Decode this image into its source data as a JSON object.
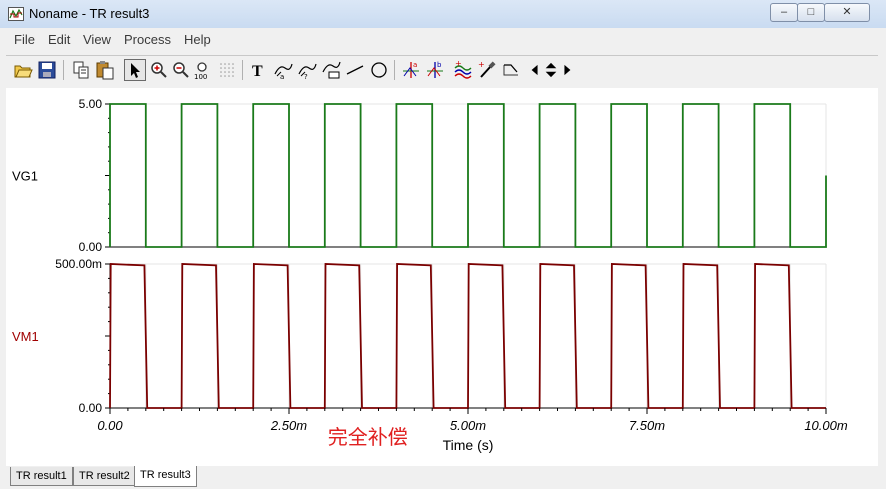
{
  "window": {
    "title": "Noname - TR result3",
    "minimize": "–",
    "maximize": "□",
    "close": "✕"
  },
  "menu": [
    "File",
    "Edit",
    "View",
    "Process",
    "Help"
  ],
  "toolbar": {
    "buttons": [
      "open-icon",
      "save-icon",
      "copy-icon",
      "paste-icon",
      "pointer-icon",
      "zoom-in-icon",
      "zoom-out-icon",
      "zoom-100-icon",
      "grid-icon",
      "text-icon",
      "label-a-icon",
      "label-b-icon",
      "legend-icon",
      "line-icon",
      "circle-icon",
      "cursor-a-icon",
      "cursor-b-icon",
      "curves-icon",
      "probe-icon",
      "step-icon",
      "left-arrow-icon",
      "up-down-icon",
      "right-arrow-icon"
    ]
  },
  "chart_data": [
    {
      "type": "line",
      "ylabel": "VG1",
      "ylim": [
        0,
        5
      ],
      "y_tick_labels": [
        "5.00",
        "0.00"
      ],
      "grid": true,
      "color": "#1a7a1a",
      "series": [
        {
          "name": "VG1",
          "x": [
            0,
            0,
            0.5,
            0.5,
            1.0,
            1.0,
            1.5,
            1.5,
            2.0,
            2.0,
            2.5,
            2.5,
            3.0,
            3.0,
            3.5,
            3.5,
            4.0,
            4.0,
            4.5,
            4.5,
            5.0,
            5.0,
            5.5,
            5.5,
            6.0,
            6.0,
            6.5,
            6.5,
            7.0,
            7.0,
            7.5,
            7.5,
            8.0,
            8.0,
            8.5,
            8.5,
            9.0,
            9.0,
            9.5,
            9.5,
            10.0,
            10.0
          ],
          "values": [
            0,
            5,
            5,
            0,
            0,
            5,
            5,
            0,
            0,
            5,
            5,
            0,
            0,
            5,
            5,
            0,
            0,
            5,
            5,
            0,
            0,
            5,
            5,
            0,
            0,
            5,
            5,
            0,
            0,
            5,
            5,
            0,
            0,
            5,
            5,
            0,
            0,
            5,
            5,
            0,
            0,
            2.5
          ]
        }
      ]
    },
    {
      "type": "line",
      "ylabel": "VM1",
      "xlabel": "Time (s)",
      "x_unit": "ms",
      "xlim": [
        0,
        10
      ],
      "ylim": [
        0,
        500
      ],
      "x_tick_labels": [
        "0.00",
        "2.50m",
        "5.00m",
        "7.50m",
        "10.00m"
      ],
      "y_tick_labels": [
        "500.00m",
        "0.00"
      ],
      "grid": true,
      "color": "#7a0000",
      "annotation": "完全补偿",
      "annotation_color": "#e02020",
      "series": [
        {
          "name": "VM1",
          "x": [
            0,
            0.01,
            0.48,
            0.52,
            1.0,
            1.01,
            1.48,
            1.52,
            2.0,
            2.01,
            2.48,
            2.52,
            3.0,
            3.01,
            3.48,
            3.52,
            4.0,
            4.01,
            4.48,
            4.52,
            5.0,
            5.01,
            5.48,
            5.52,
            6.0,
            6.01,
            6.48,
            6.52,
            7.0,
            7.01,
            7.48,
            7.52,
            8.0,
            8.01,
            8.48,
            8.52,
            9.0,
            9.01,
            9.48,
            9.52,
            10.0
          ],
          "values": [
            0,
            500,
            495,
            0,
            0,
            500,
            495,
            0,
            0,
            500,
            495,
            0,
            0,
            500,
            495,
            0,
            0,
            500,
            495,
            0,
            0,
            500,
            495,
            0,
            0,
            500,
            495,
            0,
            0,
            500,
            495,
            0,
            0,
            500,
            495,
            0,
            0,
            500,
            495,
            0,
            0
          ]
        }
      ]
    }
  ],
  "tabs": [
    "TR result1",
    "TR result2",
    "TR result3"
  ],
  "active_tab": 2
}
